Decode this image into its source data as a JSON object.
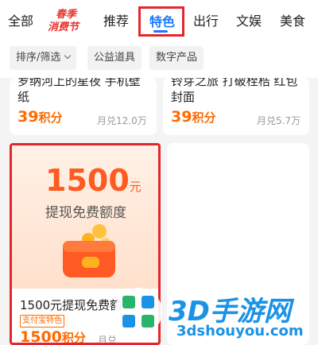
{
  "tabs": {
    "all": "全部",
    "festival_line1": "春季",
    "festival_line2": "消费节",
    "recommend": "推荐",
    "special": "特色",
    "travel": "出行",
    "entertainment": "文娱",
    "food": "美食"
  },
  "filters": [
    {
      "label": "排序/筛选"
    },
    {
      "label": "公益道具"
    },
    {
      "label": "数字产品"
    }
  ],
  "cards": [
    {
      "title_line1": "罗纳河上的星夜 手机壁",
      "title_line2": "纸",
      "price": "39",
      "price_unit": "积分",
      "sold": "月兑12.0万"
    },
    {
      "title_line1": "铃芽之旅 打破桎梏 红包",
      "title_line2": "封面",
      "price": "39",
      "price_unit": "积分",
      "sold": "月兑5.7万"
    },
    {
      "hero_amount": "1500",
      "hero_unit": "元",
      "hero_subtitle": "提现免费额度",
      "title": "1500元提现免费额",
      "badge": "支付宝特色",
      "price": "1500",
      "price_unit": "积分",
      "sold": "月兑"
    }
  ],
  "watermark": {
    "text": "3D手游网",
    "url": "3dshouyou.com"
  },
  "colors": {
    "accent": "#1677ff",
    "price": "#ff6a00",
    "highlight": "#e3262b"
  }
}
